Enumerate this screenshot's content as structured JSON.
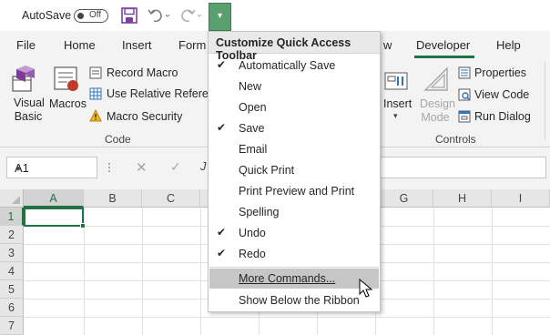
{
  "qat": {
    "autosave_label": "AutoSave",
    "autosave_state": "Off",
    "icons": [
      "save-icon",
      "undo-icon",
      "redo-icon",
      "customize-qat-icon"
    ]
  },
  "ribbon_tabs": [
    "File",
    "Home",
    "Insert",
    "Form",
    "w",
    "Developer",
    "Help"
  ],
  "active_tab": "Developer",
  "ribbon": {
    "code": {
      "visual_basic": "Visual Basic",
      "macros": "Macros",
      "record_macro": "Record Macro",
      "relative_references": "Use Relative Referenc",
      "macro_security": "Macro Security",
      "group_label": "Code"
    },
    "controls": {
      "insert": "Insert",
      "design_mode": "Design Mode",
      "properties": "Properties",
      "view_code": "View Code",
      "run_dialog": "Run Dialog",
      "group_label": "Controls"
    }
  },
  "formula_bar": {
    "name_box": "A1",
    "cancel": "✕",
    "enter": "✓",
    "fx": "J",
    "value": ""
  },
  "grid": {
    "columns": [
      "A",
      "B",
      "C",
      "G",
      "H",
      "I"
    ],
    "rows": [
      "1",
      "2",
      "3",
      "4",
      "5",
      "6",
      "7"
    ],
    "active_cell": "A1"
  },
  "menu": {
    "title": "Customize Quick Access Toolbar",
    "items": [
      {
        "label": "Automatically Save",
        "checked": true
      },
      {
        "label": "New",
        "checked": false
      },
      {
        "label": "Open",
        "checked": false
      },
      {
        "label": "Save",
        "checked": true
      },
      {
        "label": "Email",
        "checked": false
      },
      {
        "label": "Quick Print",
        "checked": false
      },
      {
        "label": "Print Preview and Print",
        "checked": false
      },
      {
        "label": "Spelling",
        "checked": false
      },
      {
        "label": "Undo",
        "checked": true
      },
      {
        "label": "Redo",
        "checked": true
      }
    ],
    "more_commands": "More Commands...",
    "show_below": "Show Below the Ribbon"
  },
  "colors": {
    "accent_green": "#217346",
    "qat_button_green": "#5aa06f",
    "save_icon_purple": "#7b3f9e"
  }
}
